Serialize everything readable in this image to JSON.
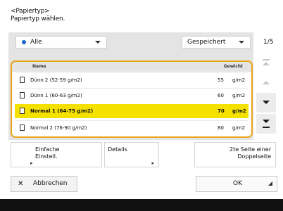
{
  "header": {
    "line1": "<Papiertyp>",
    "line2": "Papiertyp wählen."
  },
  "filter": {
    "value": "Alle"
  },
  "sort": {
    "value": "Gespeichert"
  },
  "pager": {
    "text": "1/5"
  },
  "table": {
    "col_name": "Name",
    "col_weight": "Gewicht",
    "rows": [
      {
        "name": "Dünn 2 (52-59 g/m2)",
        "num": "55",
        "unit": "g/m2",
        "selected": false
      },
      {
        "name": "Dünn 1 (60-63 g/m2)",
        "num": "60",
        "unit": "g/m2",
        "selected": false
      },
      {
        "name": "Normal 1 (64-75 g/m2)",
        "num": "70",
        "unit": "g/m2",
        "selected": true
      },
      {
        "name": "Normal 2 (76-90 g/m2)",
        "num": "80",
        "unit": "g/m2",
        "selected": false
      }
    ]
  },
  "buttons": {
    "simple": "Einfache\nEinstell.",
    "details": "Details",
    "second_side": "2te Seite einer\nDoppelseite",
    "cancel": "Abbrechen",
    "ok": "OK"
  },
  "icons": {
    "filter_dot": "blue-dot-icon",
    "scroll_top": "scroll-to-top-icon",
    "scroll_up": "scroll-up-icon",
    "scroll_down": "scroll-down-icon",
    "scroll_bottom": "scroll-to-bottom-icon",
    "close": "close-icon",
    "paper": "paper-sheet-icon"
  },
  "colors": {
    "selection": "#f5e100",
    "focus_border": "#e8a317",
    "filter_dot": "#1a64c8"
  }
}
